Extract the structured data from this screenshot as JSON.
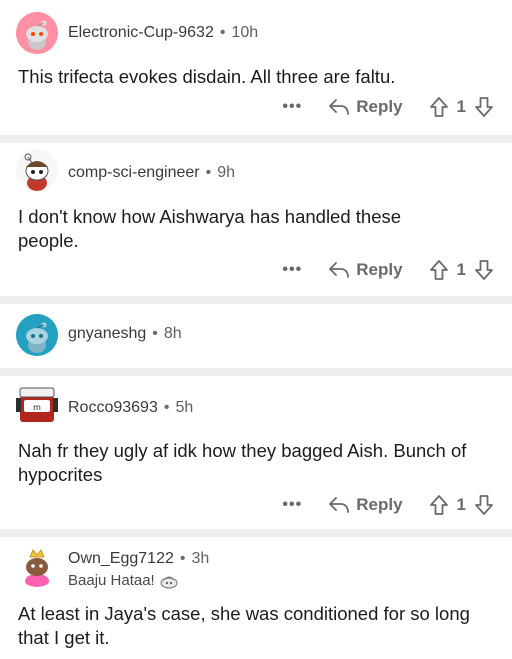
{
  "comments": [
    {
      "username": "Electronic-Cup-9632",
      "time": "10h",
      "body": "This trifecta evokes disdain. All three are faltu.",
      "reply_label": "Reply",
      "score": "1",
      "avatar_color": "#ff8fa3"
    },
    {
      "username": "comp-sci-engineer",
      "time": "9h",
      "body": "I don't know how Aishwarya has handled these people.",
      "reply_label": "Reply",
      "score": "1",
      "avatar_color": "#f2f2f2"
    },
    {
      "username": "gnyaneshg",
      "time": "8h",
      "avatar_color": "#24a0c0"
    },
    {
      "username": "Rocco93693",
      "time": "5h",
      "body": "Nah fr they ugly af idk how they bagged Aish. Bunch of hypocrites",
      "reply_label": "Reply",
      "score": "1",
      "avatar_color": "#b3261e"
    },
    {
      "username": "Own_Egg7122",
      "time": "3h",
      "flair": "Baaju Hataa!",
      "body": "At least in Jaya's case, she was conditioned for so long that I get it.",
      "avatar_color": "#ff5fb0"
    }
  ],
  "icons": {
    "more": "more-options-icon",
    "reply": "reply-arrow-icon",
    "upvote": "upvote-arrow-icon",
    "downvote": "downvote-arrow-icon"
  },
  "more_glyph": "•••"
}
